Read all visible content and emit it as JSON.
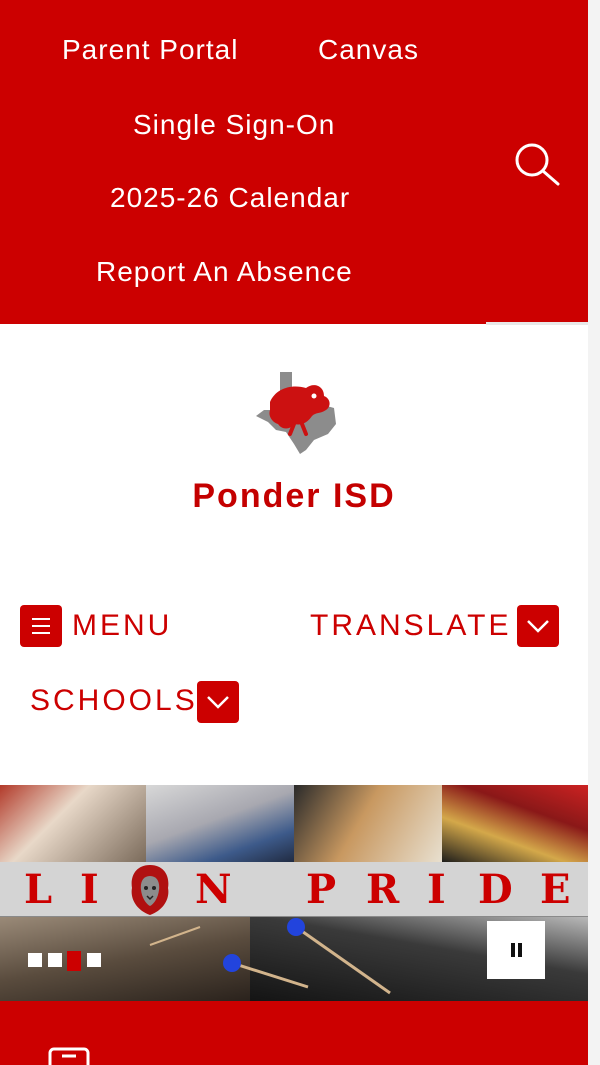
{
  "quick_links": {
    "parent_portal": "Parent Portal",
    "canvas": "Canvas",
    "single_sign_on": "Single Sign-On",
    "calendar": "2025-26 Calendar",
    "report_absence": "Report An Absence"
  },
  "search": {
    "icon": "search-icon"
  },
  "site": {
    "name": "Ponder ISD",
    "logo_icon": "texas-lion-logo-icon"
  },
  "nav": {
    "menu_label": "MENU",
    "translate_label": "TRANSLATE",
    "schools_label": "SCHOOLS"
  },
  "banner": {
    "slogan_letters": [
      "L",
      "I",
      "N",
      "P",
      "R",
      "I",
      "D",
      "E"
    ],
    "slogan_emblem": "lion-head-icon",
    "pause_icon": "pause-icon"
  },
  "colors": {
    "brand_red": "#cc0000",
    "white": "#ffffff"
  }
}
